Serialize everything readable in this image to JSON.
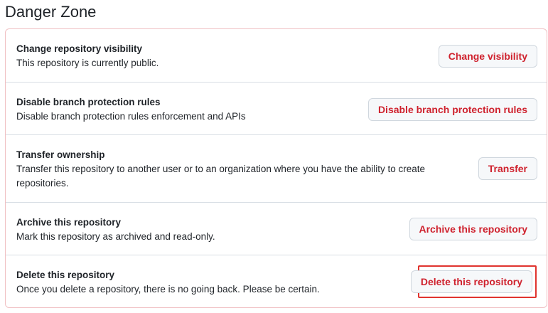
{
  "page": {
    "title": "Danger Zone"
  },
  "rows": [
    {
      "title": "Change repository visibility",
      "description": "This repository is currently public.",
      "button": "Change visibility"
    },
    {
      "title": "Disable branch protection rules",
      "description": "Disable branch protection rules enforcement and APIs",
      "button": "Disable branch protection rules"
    },
    {
      "title": "Transfer ownership",
      "description": "Transfer this repository to another user or to an organization where you have the ability to create repositories.",
      "button": "Transfer"
    },
    {
      "title": "Archive this repository",
      "description": "Mark this repository as archived and read-only.",
      "button": "Archive this repository"
    },
    {
      "title": "Delete this repository",
      "description": "Once you delete a repository, there is no going back. Please be certain.",
      "button": "Delete this repository",
      "highlighted": true
    }
  ],
  "colors": {
    "danger_text": "#cf222e",
    "danger_border": "#f0c0c3",
    "highlight": "#e0342f"
  }
}
